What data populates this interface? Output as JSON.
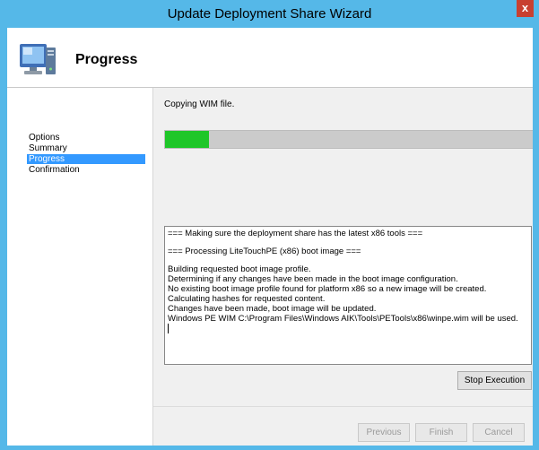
{
  "window": {
    "title": "Update Deployment Share Wizard",
    "close_glyph": "x"
  },
  "header": {
    "title": "Progress",
    "icon": "computer-icon"
  },
  "sidebar": {
    "items": [
      {
        "label": "Options",
        "active": false
      },
      {
        "label": "Summary",
        "active": false
      },
      {
        "label": "Progress",
        "active": true
      },
      {
        "label": "Confirmation",
        "active": false
      }
    ]
  },
  "main": {
    "status": "Copying WIM file.",
    "progress_fraction": 0.12,
    "log_lines": [
      "=== Making sure the deployment share has the latest x86 tools ===",
      "",
      "=== Processing LiteTouchPE (x86) boot image ===",
      "",
      "Building requested boot image profile.",
      "Determining if any changes have been made in the boot image configuration.",
      "No existing boot image profile found for platform x86 so a new image will be created.",
      "Calculating hashes for requested content.",
      "Changes have been made, boot image will be updated.",
      "Windows PE WIM C:\\Program Files\\Windows AIK\\Tools\\PETools\\x86\\winpe.wim will be used."
    ],
    "stop_label": "Stop Execution"
  },
  "footer": {
    "previous_label": "Previous",
    "finish_label": "Finish",
    "cancel_label": "Cancel"
  },
  "colors": {
    "title_bar": "#55b8e8",
    "progress_fill": "#1fc629",
    "nav_selected": "#3399ff",
    "close_button": "#c84031"
  }
}
